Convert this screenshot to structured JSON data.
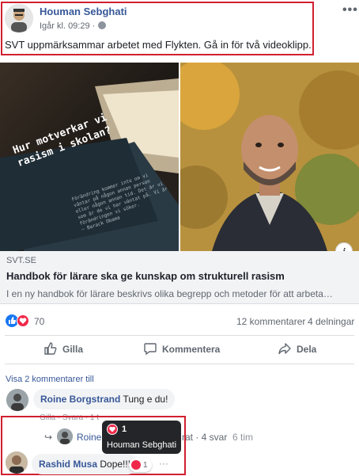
{
  "post": {
    "author": "Houman Sebghati",
    "timestamp": "Igår kl. 09:29 ·",
    "more": "•••",
    "text": "SVT uppmärksammar arbetet med Flykten. Gå in för två videoklipp."
  },
  "images": {
    "book_lines": [
      "Hur motverkar vi",
      "rasism i skolan?"
    ],
    "book_quote": "Förändring kommer inte om vi väntar på någon annan person eller någon annan tid. Det är vi som är de vi har väntat på. Vi är förändringen vi söker.",
    "book_quote_author": "— Barack Obama",
    "info_label": "i"
  },
  "link": {
    "domain": "SVT.SE",
    "title": "Handbok för lärare ska ge kunskap om strukturell rasism",
    "description": "I en ny handbok för lärare beskrivs olika begrepp och metoder för att arbeta…"
  },
  "stats": {
    "reactions": "70",
    "comments": "12 kommentarer",
    "shares": "4 delningar"
  },
  "actions": {
    "like": "Gilla",
    "comment": "Kommentera",
    "share": "Dela"
  },
  "comments": {
    "view_more": "Visa 2 kommentarer till",
    "c1": {
      "author": "Roine Borgstrand",
      "text": "Tung e du!",
      "meta": "Gilla · Svara · 1 t"
    },
    "reply": {
      "arrow": "↪",
      "author": "Roine",
      "tail": "rat · 4 svar",
      "time": "6 tim"
    },
    "tooltip": {
      "count": "1",
      "name": "Houman Sebghati"
    },
    "c2": {
      "author": "Rashid Musa",
      "text": "Dope!!!",
      "reaction_count": "1",
      "more": "···"
    }
  },
  "colors": {
    "link_blue": "#385898",
    "like_blue": "#1877f2",
    "love_red": "#f0284a",
    "highlight_red": "#d0202f"
  }
}
